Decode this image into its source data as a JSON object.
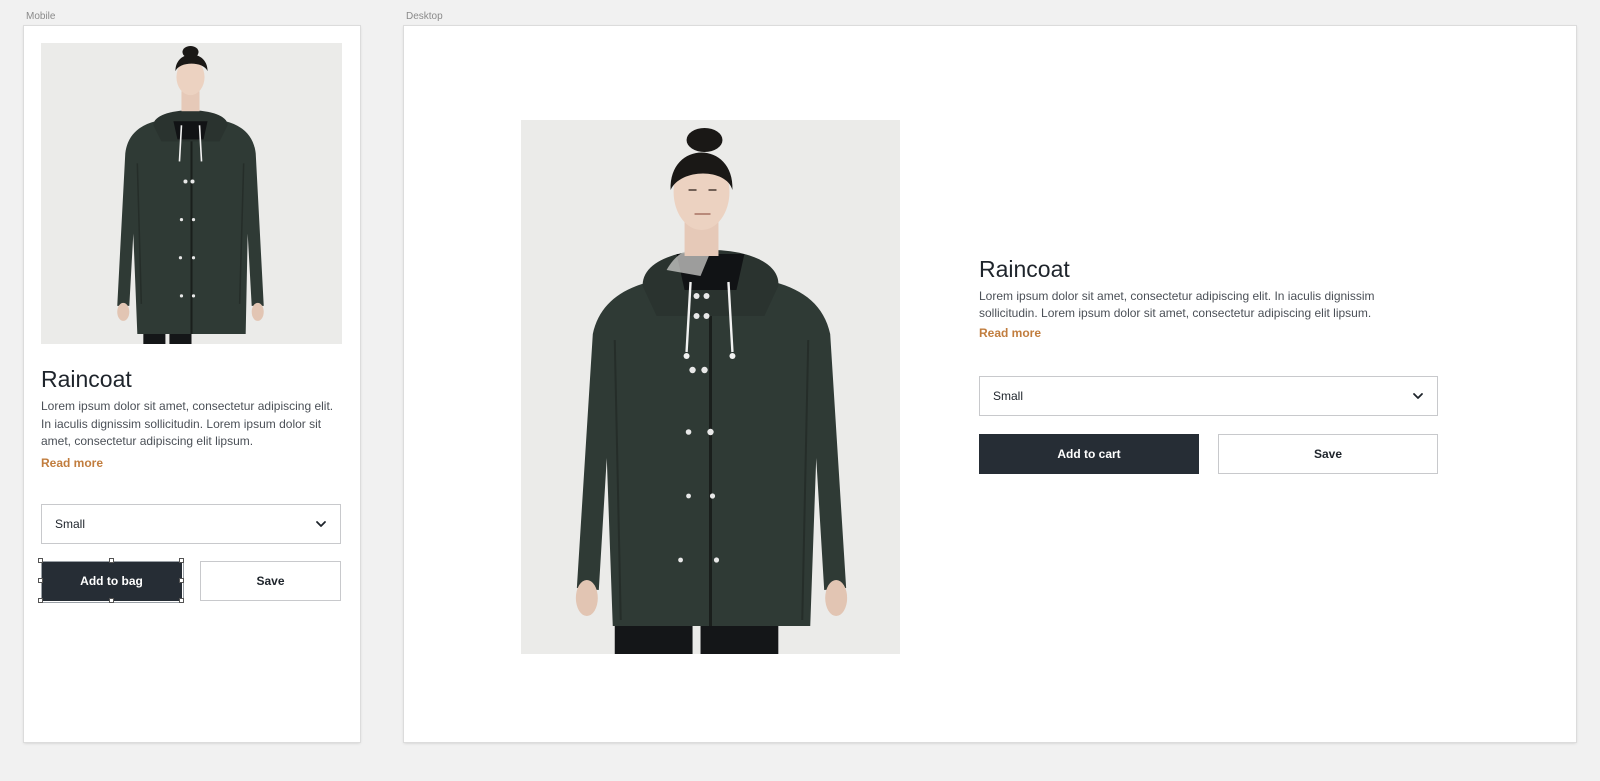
{
  "frames": {
    "mobile_label": "Mobile",
    "desktop_label": "Desktop"
  },
  "product": {
    "title": "Raincoat",
    "description_mobile": "Lorem ipsum dolor sit amet, consectetur adipiscing elit. In iaculis dignissim sollicitudin. Lorem ipsum dolor sit amet, consectetur adipiscing elit lipsum.",
    "description_desktop_line1": "Lorem ipsum dolor sit amet, consectetur adipiscing elit. In iaculis dignissim",
    "description_desktop_line2": "sollicitudin. Lorem ipsum dolor sit amet, consectetur adipiscing elit lipsum.",
    "read_more": "Read more",
    "image_icon": "raincoat-photo"
  },
  "size_select": {
    "selected": "Small",
    "icon": "chevron-down-icon"
  },
  "mobile": {
    "primary_button": "Add to bag",
    "secondary_button": "Save"
  },
  "desktop": {
    "primary_button": "Add to cart",
    "secondary_button": "Save"
  },
  "colors": {
    "accent": "#c17d3e",
    "primary_button": "#262d35",
    "coat": "#2f3a35",
    "background": "#f1f1f1"
  }
}
